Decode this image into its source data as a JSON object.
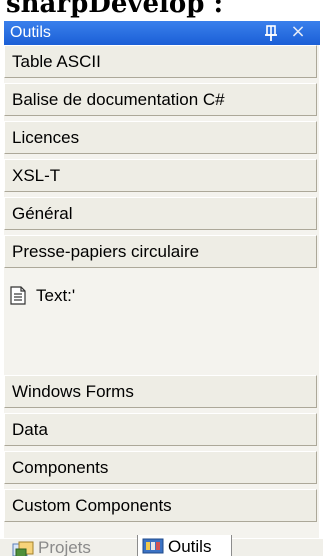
{
  "heading": "sharpDevelop :",
  "panel": {
    "title": "Outils",
    "pin_icon": "pin-icon",
    "close_glyph": "×"
  },
  "sections_top": [
    {
      "label": "Table ASCII"
    },
    {
      "label": "Balise de documentation C#"
    },
    {
      "label": "Licences"
    },
    {
      "label": "XSL-T"
    },
    {
      "label": "Général"
    },
    {
      "label": "Presse-papiers circulaire"
    }
  ],
  "tool_item": {
    "icon": "text-document-icon",
    "label": "Text:'"
  },
  "sections_bottom": [
    {
      "label": "Windows Forms"
    },
    {
      "label": "Data"
    },
    {
      "label": "Components"
    },
    {
      "label": "Custom Components"
    }
  ],
  "tabs": [
    {
      "label": "Projets",
      "icon": "projects-icon",
      "active": false
    },
    {
      "label": "Outils",
      "icon": "toolbox-icon",
      "active": true
    }
  ],
  "colors": {
    "titlebar": "#1f6be2",
    "panel_bg": "#f4f3ee",
    "section_bg": "#eeede5"
  }
}
